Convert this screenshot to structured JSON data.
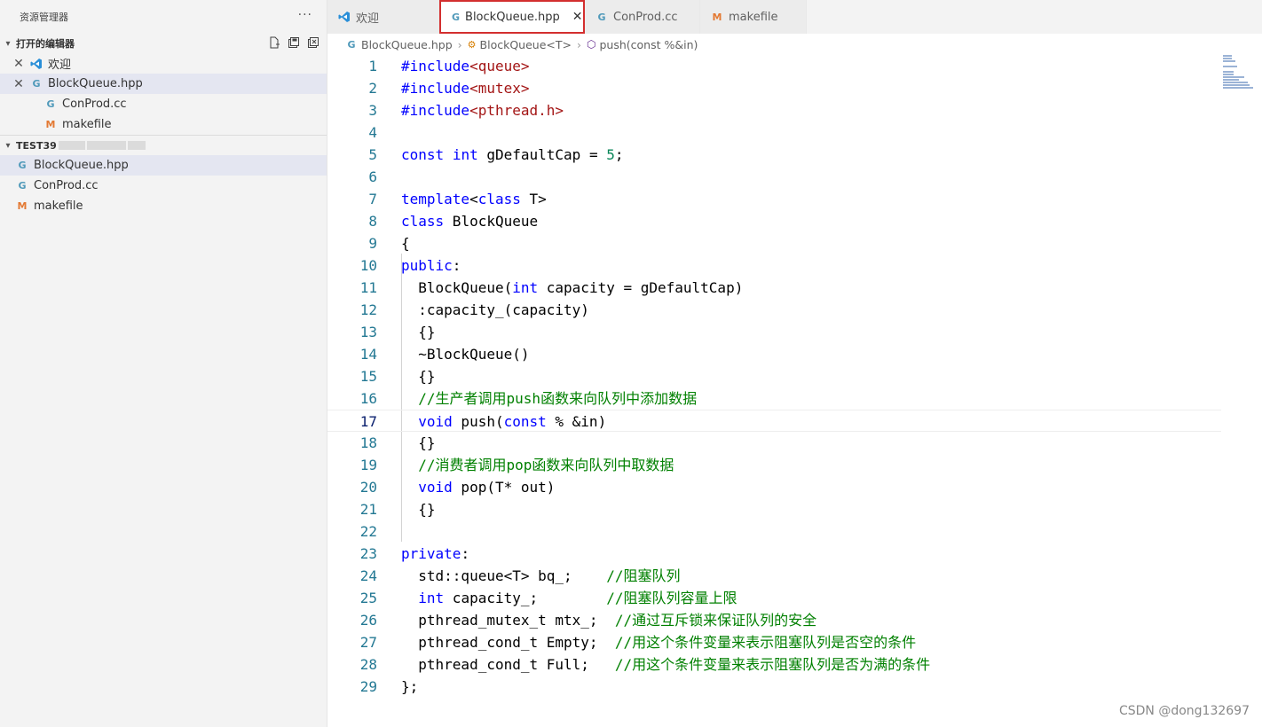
{
  "explorer": {
    "title": "资源管理器",
    "more": "···",
    "open_editors": {
      "title": "打开的编辑器",
      "items": [
        {
          "name": "欢迎",
          "icon": "vscode-icon",
          "closable": true
        },
        {
          "name": "BlockQueue.hpp",
          "icon": "cpp-icon",
          "closable": true
        },
        {
          "name": "ConProd.cc",
          "icon": "cpp-icon",
          "closable": false
        },
        {
          "name": "makefile",
          "icon": "makefile-icon",
          "closable": false
        }
      ]
    },
    "workspace": {
      "title": "TEST39",
      "items": [
        {
          "name": "BlockQueue.hpp",
          "icon": "cpp-icon"
        },
        {
          "name": "ConProd.cc",
          "icon": "cpp-icon"
        },
        {
          "name": "makefile",
          "icon": "makefile-icon"
        }
      ]
    }
  },
  "tabs": [
    {
      "label": "欢迎",
      "icon": "vscode-icon"
    },
    {
      "label": "BlockQueue.hpp",
      "icon": "cpp-icon",
      "active": true
    },
    {
      "label": "ConProd.cc",
      "icon": "cpp-icon"
    },
    {
      "label": "makefile",
      "icon": "makefile-icon"
    }
  ],
  "breadcrumb": [
    "BlockQueue.hpp",
    "BlockQueue<T>",
    "push(const %&in)"
  ],
  "editor": {
    "active_line": 17,
    "lines": [
      "#include<queue>",
      "#include<mutex>",
      "#include<pthread.h>",
      "",
      "const int gDefaultCap = 5;",
      "",
      "template<class T>",
      "class BlockQueue",
      "{",
      "public:",
      "  BlockQueue(int capacity = gDefaultCap)",
      "  :capacity_(capacity)",
      "  {}",
      "  ~BlockQueue()",
      "  {}",
      "  //生产者调用push函数来向队列中添加数据",
      "  void push(const % &in)",
      "  {}",
      "  //消费者调用pop函数来向队列中取数据",
      "  void pop(T* out)",
      "  {}",
      "",
      "private:",
      "  std::queue<T> bq_;    //阻塞队列",
      "  int capacity_;        //阻塞队列容量上限",
      "  pthread_mutex_t mtx_;  //通过互斥锁来保证队列的安全",
      "  pthread_cond_t Empty;  //用这个条件变量来表示阻塞队列是否空的条件",
      "  pthread_cond_t Full;   //用这个条件变量来表示阻塞队列是否为满的条件",
      "};"
    ]
  },
  "watermark": "CSDN @dong132697",
  "colors": {
    "keyword": "#0000ff",
    "string": "#a31515",
    "number": "#098658",
    "comment": "#008000",
    "line_number": "#237893",
    "active_tab_border": "#d32f2f"
  }
}
